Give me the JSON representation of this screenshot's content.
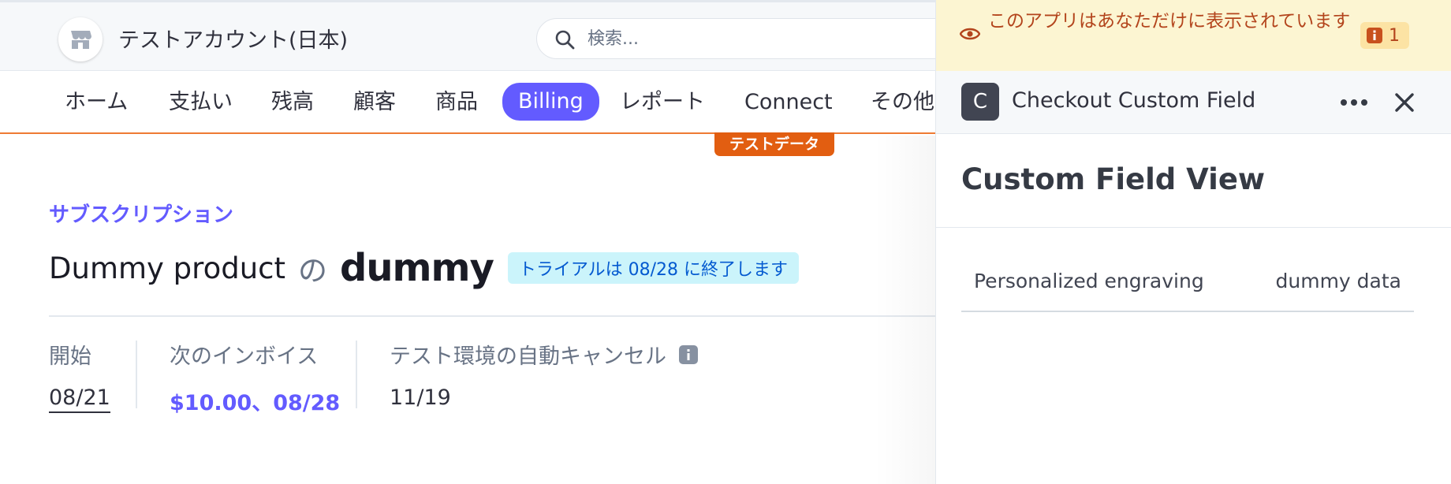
{
  "topbar": {
    "account_name": "テストアカウント(日本)",
    "account_icon": "storefront-icon",
    "search_placeholder": "検索..."
  },
  "nav": {
    "items": [
      {
        "label": "ホーム"
      },
      {
        "label": "支払い"
      },
      {
        "label": "残高"
      },
      {
        "label": "顧客"
      },
      {
        "label": "商品"
      },
      {
        "label": "Billing",
        "active": true
      },
      {
        "label": "レポート"
      },
      {
        "label": "Connect"
      },
      {
        "label": "その他"
      }
    ],
    "test_tag": "テストデータ"
  },
  "main": {
    "breadcrumb": "サブスクリプション",
    "title_product": "Dummy product",
    "title_connector": "の",
    "title_customer": "dummy",
    "trial_badge": "トライアルは 08/28 に終了します",
    "stats": [
      {
        "label": "開始",
        "value": "08/21"
      },
      {
        "label": "次のインボイス",
        "value": "$10.00、08/28"
      },
      {
        "label": "テスト環境の自動キャンセル",
        "value": "11/19"
      }
    ]
  },
  "drawer": {
    "notice_text": "このアプリはあなただけに表示されています",
    "notice_badge_count": "1",
    "app_icon_letter": "C",
    "app_name": "Checkout Custom Field",
    "view_title": "Custom Field View",
    "field": {
      "key": "Personalized engraving",
      "value": "dummy data"
    }
  },
  "colors": {
    "accent": "#635bff",
    "test_mode": "#e25e11",
    "notice_bg": "#fcf5d2",
    "notice_text": "#b3441c",
    "trial_bg": "#cbf4fb"
  }
}
